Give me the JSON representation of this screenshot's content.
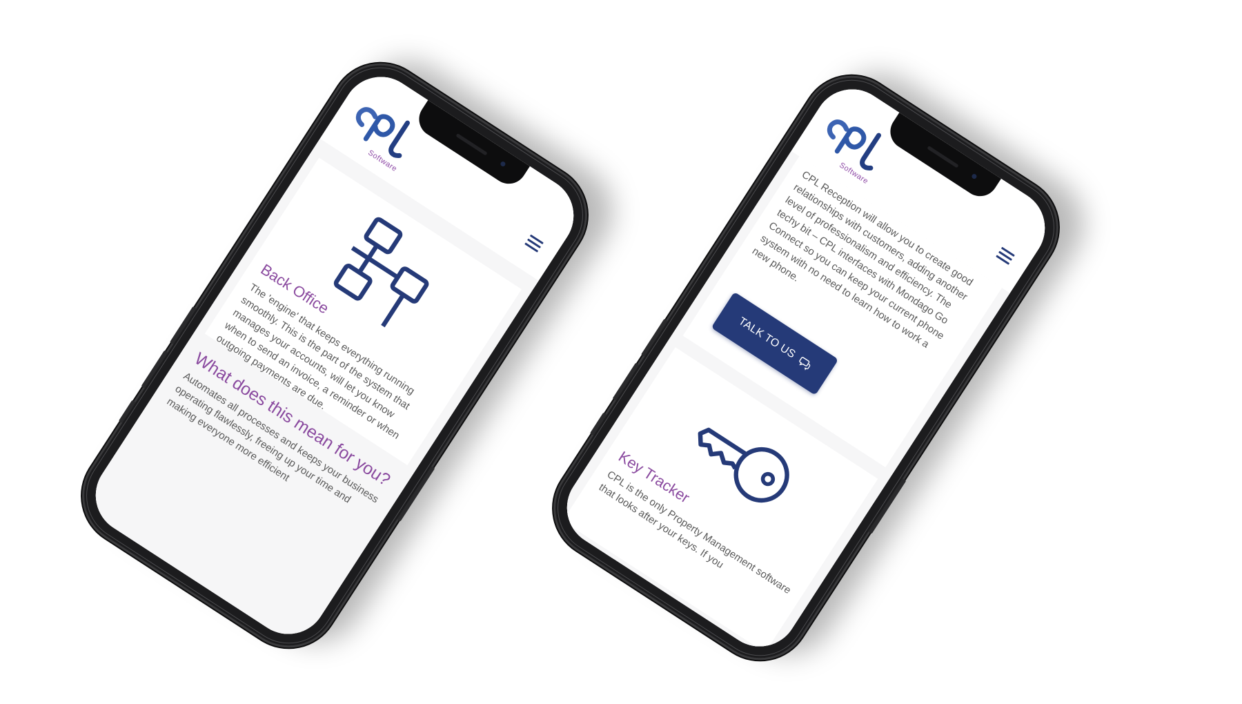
{
  "brand": {
    "logo_text": "cpl",
    "logo_subtitle": "Software",
    "primary_color": "#253a78",
    "accent_color": "#8a4a9f"
  },
  "phone_left": {
    "feature": {
      "icon": "network-diagram-icon",
      "title": "Back Office",
      "description": "The 'engine' that keeps everything running smoothly. This is the part of the system that manages your accounts, will let you know when to send an invoice, a reminder or when outgoing payments are due."
    },
    "section": {
      "heading": "What does this mean for you?",
      "text": "Automates all processes and keeps your business operating flawlessly, freeing up your time and making everyone more efficient"
    }
  },
  "phone_right": {
    "intro_text": "CPL Reception will allow you to create good relationships with customers, adding another level of professionalism and efficiency. The techy bit – CPL interfaces with Mondago Go Connect so you can keep your current phone system with no need to learn how to work a new phone.",
    "cta": {
      "label": "TALK TO US",
      "icon": "chat-bubble-icon"
    },
    "feature": {
      "icon": "key-icon",
      "title": "Key Tracker",
      "description": "CPL is the only Property Management software that looks after your keys. If you"
    }
  }
}
